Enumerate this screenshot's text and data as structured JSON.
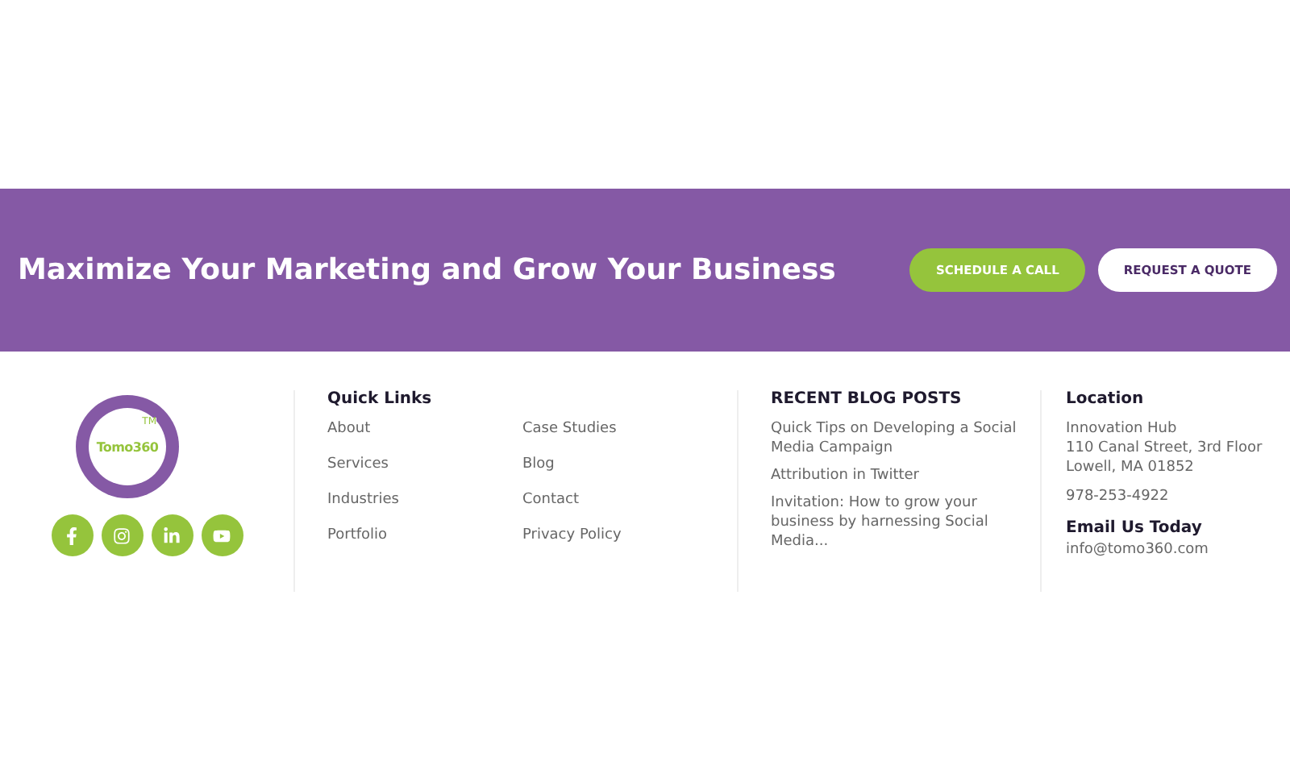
{
  "banner": {
    "headline": "Maximize Your Marketing and Grow Your Business",
    "buttons": [
      {
        "label": "SCHEDULE A CALL",
        "kind": "primary"
      },
      {
        "label": "REQUEST A QUOTE",
        "kind": "secondary"
      }
    ]
  },
  "brand": {
    "logo_text": "Tomo360",
    "trademark": "TM",
    "social": [
      {
        "kind": "facebook"
      },
      {
        "kind": "instagram"
      },
      {
        "kind": "linkedin"
      },
      {
        "kind": "youtube"
      }
    ]
  },
  "quick_links": {
    "title": "Quick Links",
    "columns": [
      [
        "About",
        "Services",
        "Industries",
        "Portfolio"
      ],
      [
        "Case Studies",
        "Blog",
        "Contact",
        "Privacy Policy"
      ]
    ]
  },
  "blog": {
    "title": "RECENT BLOG POSTS",
    "posts": [
      "Quick Tips on Developing a Social Media Campaign",
      "Attribution in Twitter",
      "Invitation: How to grow your business by harnessing Social Media..."
    ]
  },
  "location": {
    "title": "Location",
    "address": [
      "Innovation Hub",
      "110 Canal Street, 3rd Floor",
      "Lowell, MA 01852"
    ],
    "phone": "978-253-4922",
    "email_title": "Email Us Today",
    "email": "info@tomo360.com"
  }
}
